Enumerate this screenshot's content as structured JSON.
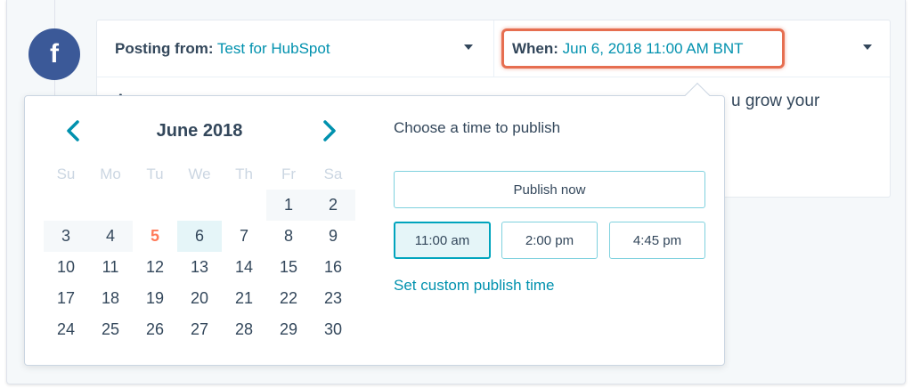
{
  "post": {
    "posting_from_label": "Posting from:",
    "posting_from_value": "Test for HubSpot",
    "when_label": "When:",
    "when_value": "Jun 6, 2018 11:00 AM BNT",
    "text_partial_left": "A",
    "text_partial_right": "u grow your",
    "avatar_letter": "f"
  },
  "calendar": {
    "month_title": "June 2018",
    "weekdays": [
      "Su",
      "Mo",
      "Tu",
      "We",
      "Th",
      "Fr",
      "Sa"
    ],
    "weeks": [
      [
        "",
        "",
        "",
        "",
        "",
        "1",
        "2"
      ],
      [
        "3",
        "4",
        "5",
        "6",
        "7",
        "8",
        "9"
      ],
      [
        "10",
        "11",
        "12",
        "13",
        "14",
        "15",
        "16"
      ],
      [
        "17",
        "18",
        "19",
        "20",
        "21",
        "22",
        "23"
      ],
      [
        "24",
        "25",
        "26",
        "27",
        "28",
        "29",
        "30"
      ]
    ],
    "today": "5",
    "selected": "6"
  },
  "publish": {
    "title": "Choose a time to publish",
    "publish_now_label": "Publish now",
    "times": [
      "11:00 am",
      "2:00 pm",
      "4:45 pm"
    ],
    "selected_time": "11:00 am",
    "custom_link_label": "Set custom publish time"
  },
  "colors": {
    "accent": "#0091ae",
    "highlight_border": "#e66e50",
    "today": "#ff7a59",
    "facebook": "#3b5998"
  },
  "icons": {
    "prev": "chevron-left-icon",
    "next": "chevron-right-icon",
    "dropdown": "caret-down-icon"
  }
}
